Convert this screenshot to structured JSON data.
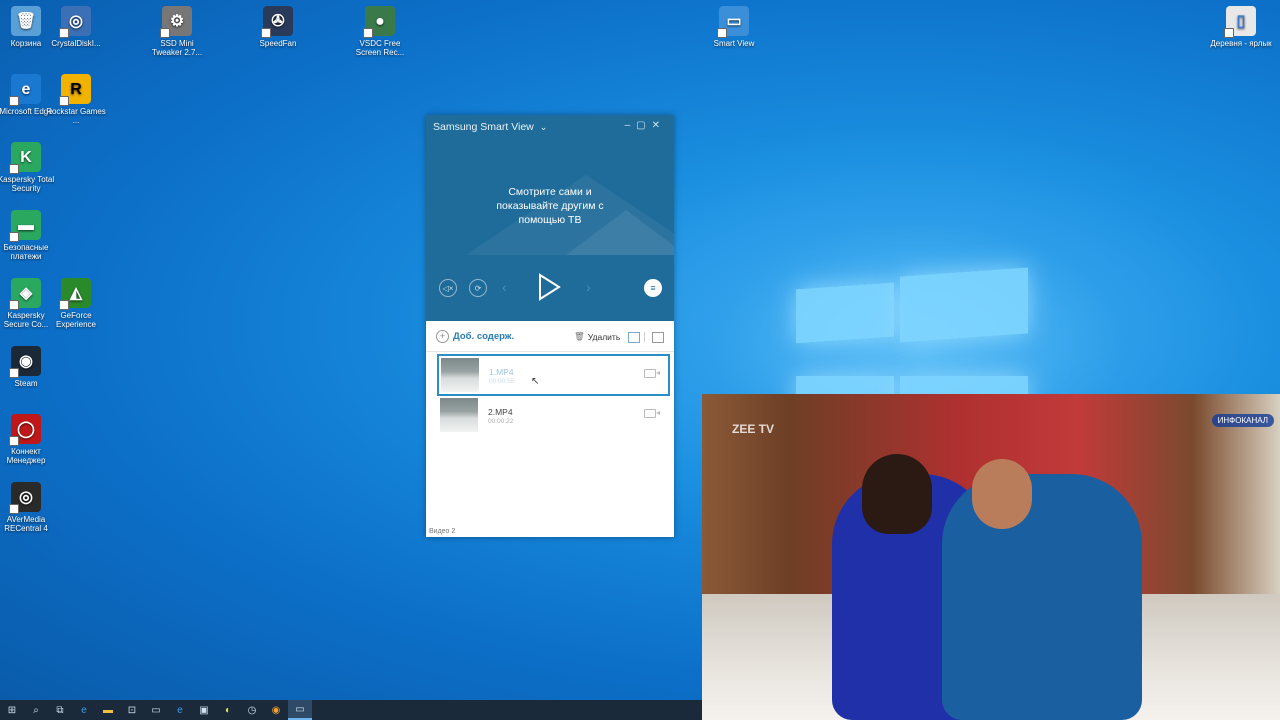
{
  "desktop": {
    "icons": [
      {
        "label": "Корзина",
        "glyph": "🗑",
        "color": "#5aa0d8"
      },
      {
        "label": "CrystalDiskI...",
        "glyph": "◎",
        "color": "#3b6fb6"
      },
      {
        "label": "SSD Mini Tweaker 2.7...",
        "glyph": "⚙",
        "color": "#777777"
      },
      {
        "label": "SpeedFan",
        "glyph": "✇",
        "color": "#2a3a5a"
      },
      {
        "label": "VSDC Free Screen Rec...",
        "glyph": "●",
        "color": "#3a7a4a"
      },
      {
        "label": "Smart View",
        "glyph": "▭",
        "color": "#3a8fd8"
      },
      {
        "label": "Деревня - ярлык",
        "glyph": "▯",
        "color": "#e8e8e8"
      },
      {
        "label": "Microsoft Edge",
        "glyph": "e",
        "color": "#1a78d0"
      },
      {
        "label": "Rockstar Games ...",
        "glyph": "R",
        "color": "#f2b200"
      },
      {
        "label": "Kaspersky Total Security",
        "glyph": "K",
        "color": "#2aa860"
      },
      {
        "label": "Безопасные платежи",
        "glyph": "▬",
        "color": "#2aa860"
      },
      {
        "label": "Kaspersky Secure Co...",
        "glyph": "◈",
        "color": "#2aa860"
      },
      {
        "label": "GeForce Experience",
        "glyph": "◭",
        "color": "#2a8a2a"
      },
      {
        "label": "Steam",
        "glyph": "◉",
        "color": "#1b2838"
      },
      {
        "label": "Коннект Менеджер",
        "glyph": "◯",
        "color": "#c01818"
      },
      {
        "label": "AVerMedia RECentral 4",
        "glyph": "◎",
        "color": "#2a2a2a"
      }
    ]
  },
  "window": {
    "title": "Samsung Smart View",
    "message_line1": "Смотрите сами и",
    "message_line2": "показывайте другим с",
    "message_line3": "помощью ТВ",
    "add_label": "Доб. содерж.",
    "delete_label": "Удалить",
    "footer": "Видео 2",
    "items": [
      {
        "name": "1.MP4",
        "duration": "00:00:55"
      },
      {
        "name": "2.MP4",
        "duration": "00:00:22"
      }
    ]
  },
  "tv": {
    "channel": "ZEE TV",
    "badge": "ИНФОКАНАЛ"
  }
}
